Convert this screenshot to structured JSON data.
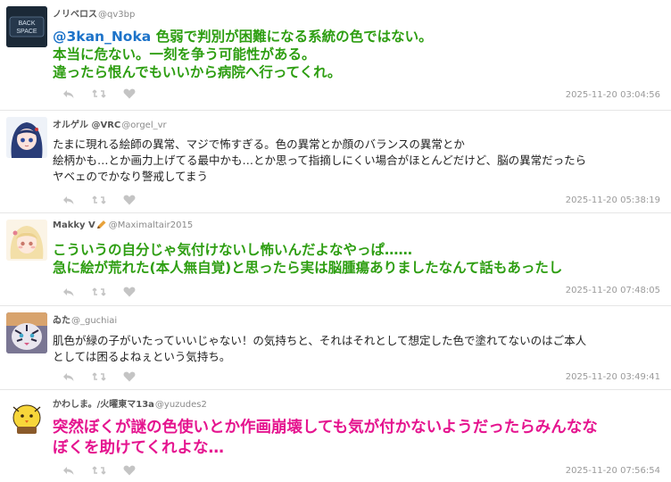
{
  "tweets": [
    {
      "user": "ノリベロス",
      "handle": "@qv3bp",
      "avatar_text": [
        "BACK",
        "SPACE"
      ],
      "lines": [
        [
          {
            "t": "@3kan_Noka",
            "c": "mention"
          },
          {
            "t": " 色弱で判別が困難になる系統の色ではない。",
            "c": "green"
          }
        ],
        [
          {
            "t": "本当に危ない。一刻を争う可能性がある。",
            "c": "green"
          }
        ],
        [
          {
            "t": "違ったら恨んでもいいから病院へ行ってくれ。",
            "c": "green"
          }
        ]
      ],
      "time": "2025-11-20 03:04:56"
    },
    {
      "user": "オルゲル @VRC",
      "handle": "@orgel_vr",
      "lines": [
        [
          {
            "t": "たまに現れる絵師の異常、マジで怖すぎる。色の異常とか顔のバランスの異常とか",
            "c": ""
          }
        ],
        [
          {
            "t": "絵柄かも…とか画力上げてる最中かも…とか思って指摘しにくい場合がほとんどだけど、脳の異常だったら",
            "c": ""
          }
        ],
        [
          {
            "t": "ヤベェのでかなり警戒してまう",
            "c": ""
          }
        ]
      ],
      "time": "2025-11-20 05:38:19"
    },
    {
      "user": "Makky V",
      "handle": "@Maximaltair2015",
      "lines": [
        [
          {
            "t": "こういうの自分じゃ気付けないし怖いんだよなやっぱ……",
            "c": "green"
          }
        ],
        [
          {
            "t": "急に絵が荒れた(本人無自覚)と思ったら実は脳腫瘍ありましたなんて話もあったし",
            "c": "green"
          }
        ]
      ],
      "time": "2025-11-20 07:48:05"
    },
    {
      "user": "ゐた",
      "handle": "@_guchiai",
      "lines": [
        [
          {
            "t": "肌色が緑の子がいたっていいじゃない！の気持ちと、それはそれとして想定した色で塗れてないのはご本人",
            "c": ""
          }
        ],
        [
          {
            "t": "としては困るよねぇという気持ち。",
            "c": ""
          }
        ]
      ],
      "time": "2025-11-20 03:49:41"
    },
    {
      "user": "かわしま。/火曜東マ13a",
      "handle": "@yuzudes2",
      "lines": [
        [
          {
            "t": "突然ぼくが謎の色使いとか作画崩壊しても気が付かないようだったらみんなな",
            "c": "magenta"
          }
        ],
        [
          {
            "t": "ぼくを助けてくれよな…",
            "c": "magenta"
          }
        ]
      ],
      "time": "2025-11-20 07:56:54"
    }
  ],
  "icons": [
    "reply-icon",
    "retweet-icon",
    "like-icon"
  ],
  "colors": {
    "green": "#2e9e12",
    "magenta": "#e5148f",
    "mention": "#1d73c9",
    "meta": "#9a9a9a",
    "icon": "#c4c4c4"
  }
}
